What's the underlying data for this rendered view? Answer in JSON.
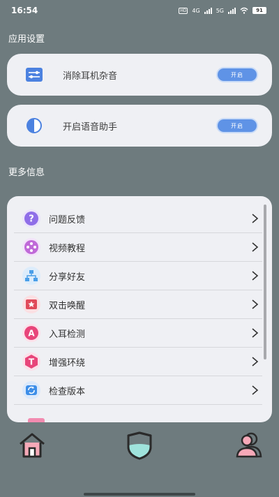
{
  "status_bar": {
    "time": "16:54",
    "hd": "HD",
    "net1": "4G",
    "net2": "5G",
    "battery": "91"
  },
  "settings": {
    "section_title": "应用设置",
    "noise_cancel": {
      "label": "消除耳机杂音",
      "button": "开启",
      "icon": "equalizer-icon"
    },
    "voice_assistant": {
      "label": "开启语音助手",
      "button": "开启",
      "icon": "contrast-half-icon"
    }
  },
  "more_info": {
    "section_title": "更多信息",
    "items": [
      {
        "label": "问题反馈",
        "icon": "question-icon",
        "color": "#8f6ee8"
      },
      {
        "label": "视频教程",
        "icon": "film-reel-icon",
        "color": "#b25ad8"
      },
      {
        "label": "分享好友",
        "icon": "share-network-icon",
        "color": "#4a9ee8"
      },
      {
        "label": "双击唤醒",
        "icon": "star-badge-icon",
        "color": "#e04a5a"
      },
      {
        "label": "入耳检测",
        "icon": "letter-a-icon",
        "color": "#e8457a"
      },
      {
        "label": "增强环绕",
        "icon": "letter-t-icon",
        "color": "#e8457a"
      },
      {
        "label": "检查版本",
        "icon": "refresh-icon",
        "color": "#3d8ee8"
      }
    ]
  },
  "tabbar": {
    "home": "home-icon",
    "protect": "shield-icon",
    "profile": "user-icon"
  },
  "colors": {
    "background": "#6e7b7e",
    "card": "#eff0f4",
    "button": "#5f93e6",
    "tab_active_fill": "#f6a9b8",
    "tab_fill_teal": "#9fe3dc"
  }
}
